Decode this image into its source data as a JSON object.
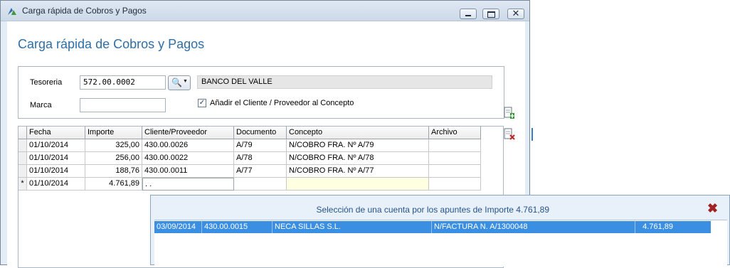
{
  "window": {
    "title": "Carga rápida de Cobros y Pagos",
    "min_glyph": "",
    "close_glyph": "✕"
  },
  "page": {
    "title": "Carga rápida de Cobros y Pagos"
  },
  "form": {
    "tesoreria_label": "Tesoreria",
    "tesoreria_value": "572.00.0002",
    "bank_name": "BANCO DEL VALLE",
    "marca_label": "Marca",
    "marca_value": "",
    "add_client_checkbox_label": "Añadir el Cliente / Proveedor al Concepto",
    "add_client_checked": true,
    "check_mark": "✓",
    "lookup_icon": "🔍",
    "lookup_arrow": "▼"
  },
  "grid": {
    "columns": [
      "Fecha",
      "Importe",
      "Cliente/Proveedor",
      "Documento",
      "Concepto",
      "Archivo"
    ],
    "rows": [
      {
        "marker": "",
        "fecha": "01/10/2014",
        "importe": "325,00",
        "cliente": "430.00.0026",
        "documento": "A/79",
        "concepto": "N/COBRO FRA. Nº A/79",
        "archivo": ""
      },
      {
        "marker": "",
        "fecha": "01/10/2014",
        "importe": "256,00",
        "cliente": "430.00.0022",
        "documento": "A/78",
        "concepto": "N/COBRO FRA. Nº A/78",
        "archivo": ""
      },
      {
        "marker": "",
        "fecha": "01/10/2014",
        "importe": "188,76",
        "cliente": "430.00.0011",
        "documento": "A/77",
        "concepto": "N/COBRO FRA. Nº A/77",
        "archivo": ""
      },
      {
        "marker": "*",
        "fecha": "01/10/2014",
        "importe": "4.761,89",
        "cliente": ". .",
        "documento": "",
        "concepto": "",
        "archivo": ""
      }
    ]
  },
  "popup": {
    "title": "Selección de una cuenta por los apuntes de Importe 4.761,89",
    "close_glyph": "✖",
    "rows": [
      {
        "fecha": "03/09/2014",
        "cuenta": "430.00.0015",
        "nombre": "NECA SILLAS S.L.",
        "concepto": "N/FACTURA N. A/1300048",
        "importe": "4.761,89"
      }
    ]
  },
  "colors": {
    "accent": "#2e6fa8",
    "selection": "#3b8fe2",
    "close_red": "#a22222"
  }
}
